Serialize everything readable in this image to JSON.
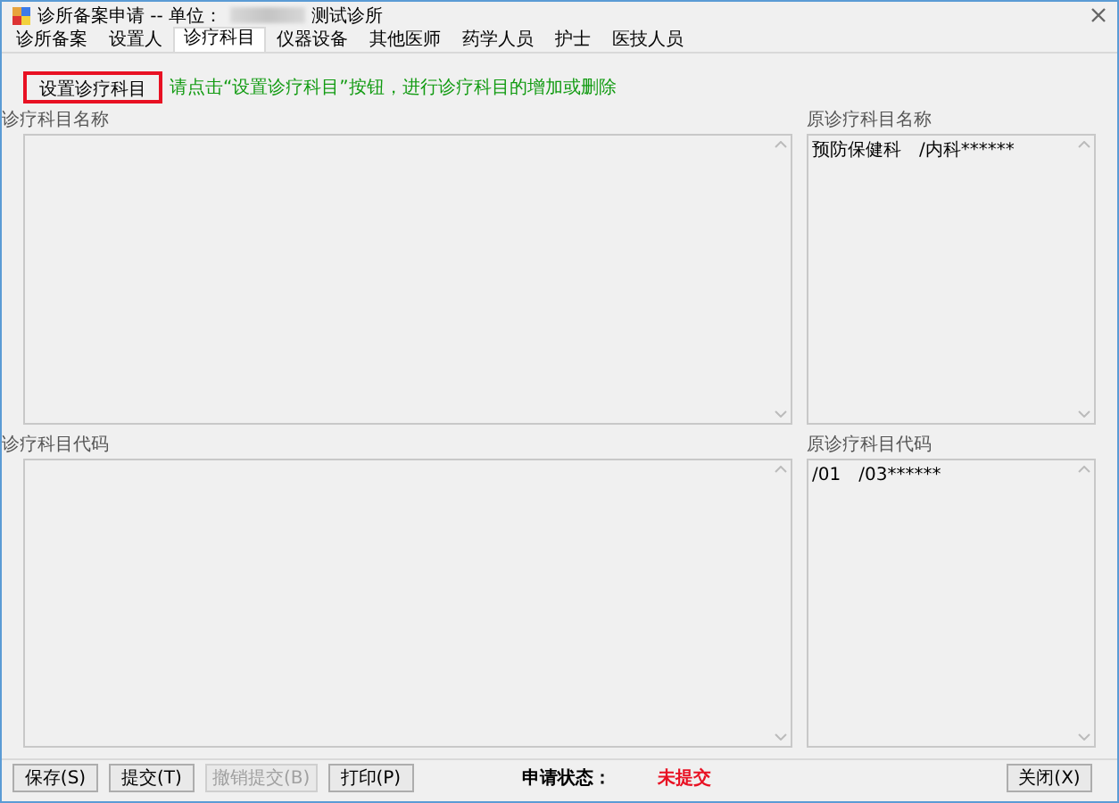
{
  "window": {
    "title": "诊所备案申请 -- 单位：",
    "title_suffix": "测试诊所"
  },
  "tabs": [
    {
      "label": "诊所备案",
      "selected": false
    },
    {
      "label": "设置人",
      "selected": false
    },
    {
      "label": "诊疗科目",
      "selected": true
    },
    {
      "label": "仪器设备",
      "selected": false
    },
    {
      "label": "其他医师",
      "selected": false
    },
    {
      "label": "药学人员",
      "selected": false
    },
    {
      "label": "护士",
      "selected": false
    },
    {
      "label": "医技人员",
      "selected": false
    }
  ],
  "setup_button": "设置诊疗科目",
  "hint": "请点击“设置诊疗科目”按钮，进行诊疗科目的增加或删除",
  "fields": [
    {
      "label": "诊疗科目名称"
    },
    {
      "label": "原诊疗科目名称",
      "value": "预防保健科　/内科******"
    },
    {
      "label": "诊疗科目代码"
    },
    {
      "label": "原诊疗科目代码",
      "value": "/01　/03******"
    }
  ],
  "buttons": [
    {
      "label": "保存(S)",
      "disabled": false
    },
    {
      "label": "提交(T)",
      "disabled": false
    },
    {
      "label": "撤销提交(B)",
      "disabled": true
    },
    {
      "label": "打印(P)",
      "disabled": false
    }
  ],
  "status": {
    "label": "申请状态：",
    "value": "未提交"
  },
  "close_button": "关闭(X)"
}
